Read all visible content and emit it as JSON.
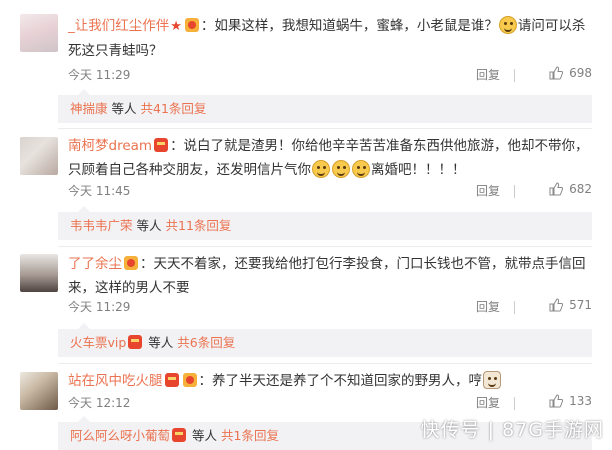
{
  "comments": [
    {
      "username": "_让我们红尘作伴",
      "text_before_emoji": "：如果这样，我想知道蜗牛，蜜蜂，小老鼠是谁？",
      "text_after_emoji": "请问可以杀死这只青蛙吗？",
      "time": "今天 11:29",
      "reply_label": "回复",
      "likes": "698",
      "sub_user": "神揣康",
      "sub_mid": "等人",
      "sub_more": "共41条回复"
    },
    {
      "username": "南柯梦dream",
      "text_before_emoji": "：说白了就是渣男！你给他辛辛苦苦准备东西供他旅游，他却不带你，只顾着自己各种交朋友，还发明信片气你",
      "text_after_emoji": "离婚吧！！！！",
      "time": "今天 11:45",
      "reply_label": "回复",
      "likes": "682",
      "sub_user": "韦韦韦广荣",
      "sub_mid": "等人",
      "sub_more": "共11条回复"
    },
    {
      "username": "了了余尘",
      "text": "：天天不着家，还要我给他打包行李投食，门口长钱也不管，就带点手信回来，这样的男人不要",
      "time": "今天 11:29",
      "reply_label": "回复",
      "likes": "571",
      "sub_user": "火车票vip",
      "sub_mid": "等人",
      "sub_more": "共6条回复"
    },
    {
      "username": "站在风中吃火腿",
      "text": "：养了半天还是养了个不知道回家的野男人，哼",
      "time": "今天 12:12",
      "reply_label": "回复",
      "likes": "133",
      "sub_user": "阿么阿么呀小葡萄",
      "sub_mid": "等人",
      "sub_more": "共1条回复"
    }
  ],
  "watermark": "快传号 | 87G手游网",
  "colors": {
    "accent": "#eb7350",
    "meta": "#808080",
    "sub_bg": "#f2f2f5"
  }
}
